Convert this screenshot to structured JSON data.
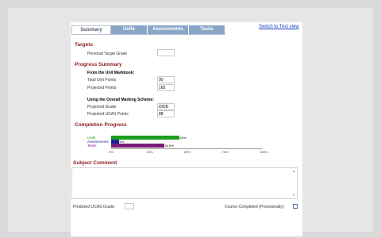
{
  "tabs": [
    {
      "label": "Summary",
      "active": true
    },
    {
      "label": "Units",
      "active": false
    },
    {
      "label": "Assessments",
      "active": false
    },
    {
      "label": "Tasks",
      "active": false
    }
  ],
  "switch_link": "Switch to Text view",
  "targets": {
    "title": "Targets",
    "personal_target_grade_label": "Personal Target Grade",
    "personal_target_grade_value": ""
  },
  "progress_summary": {
    "title": "Progress Summary",
    "unit_markbook_heading": "From the Unit Markbook:",
    "total_unit_points_label": "Total Unit Points",
    "total_unit_points_value": "90",
    "projected_points_label": "Projected Points",
    "projected_points_value": "165",
    "overall_scheme_heading": "Using the Overall Marking Scheme:",
    "projected_grade_label": "Projected Grade",
    "projected_grade_value": "D/DD",
    "projected_ucas_label": "Projected UCAS Points",
    "projected_ucas_value": "88"
  },
  "completion_progress": {
    "title": "Completion Progress",
    "colors": {
      "units": "#1e9e1e",
      "assessments": "#2020a0",
      "tasks": "#7a1a7a"
    }
  },
  "chart_data": {
    "type": "bar",
    "orientation": "horizontal",
    "categories": [
      "Units",
      "Assessments",
      "Tasks"
    ],
    "values": [
      45,
      5,
      35
    ],
    "value_labels": [
      "44%",
      "6%",
      "34.5%"
    ],
    "xlim": [
      0,
      100
    ],
    "x_ticks": [
      "0%",
      "25%",
      "50%",
      "75%",
      "100%"
    ]
  },
  "subject_comment": {
    "title": "Subject Comment",
    "text": ""
  },
  "bottom": {
    "predicted_ucas_label": "Predicted UCAS Grade:",
    "predicted_ucas_value": "",
    "course_completed_label": "Course Completed (Provisionally):"
  }
}
